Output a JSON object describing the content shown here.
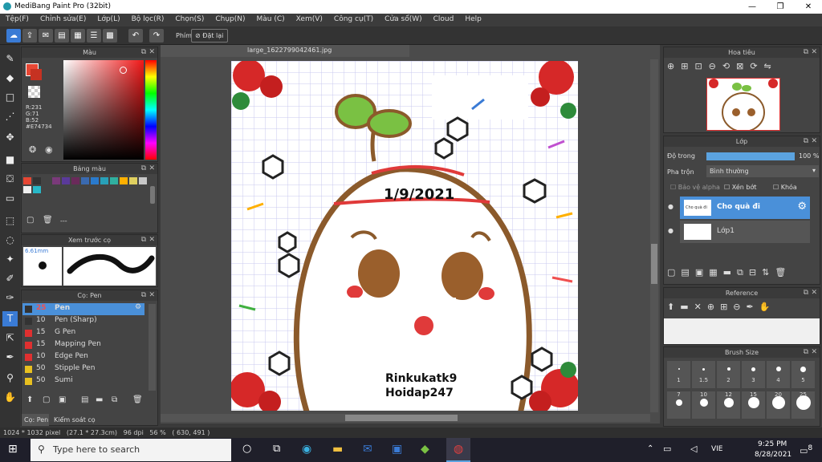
{
  "window": {
    "title": "MediBang Paint Pro (32bit)",
    "min": "—",
    "max": "❐",
    "close": "✕"
  },
  "menu": [
    "Tệp(F)",
    "Chỉnh sửa(E)",
    "Lớp(L)",
    "Bộ lọc(R)",
    "Chọn(S)",
    "Chụp(N)",
    "Màu (C)",
    "Xem(V)",
    "Công cụ(T)",
    "Cửa sổ(W)",
    "Cloud",
    "Help"
  ],
  "toolbar": {
    "shortcut_label": "Phím",
    "reset_label": "Đặt lại"
  },
  "color_panel": {
    "title": "Màu",
    "r": "R:231",
    "g": "G:71",
    "b": "B:52",
    "hex": "#E74734",
    "main_color": "#E74734"
  },
  "palette": {
    "title": "Bảng màu",
    "colors": [
      "#e74734",
      "#333333",
      "#444444",
      "#7a3a7a",
      "#5a3a9a",
      "#6a2a5a",
      "#3a6ab0",
      "#2a7acc",
      "#28a0b8",
      "#30b0a0",
      "#ffb000",
      "#e0d060",
      "#c8c8c8",
      "#f0f0f0",
      "#28b8c8"
    ],
    "footer": "---"
  },
  "brush_preview": {
    "title": "Xem trước cọ",
    "size": "6.61mm"
  },
  "brush_panel": {
    "title": "Cọ: Pen",
    "items": [
      {
        "size": "25",
        "name": "Pen",
        "color": "#333333"
      },
      {
        "size": "10",
        "name": "Pen (Sharp)",
        "color": "#333333"
      },
      {
        "size": "15",
        "name": "G Pen",
        "color": "#e03030"
      },
      {
        "size": "15",
        "name": "Mapping Pen",
        "color": "#e03030"
      },
      {
        "size": "10",
        "name": "Edge Pen",
        "color": "#e03030"
      },
      {
        "size": "50",
        "name": "Stipple Pen",
        "color": "#e8c020"
      },
      {
        "size": "50",
        "name": "Sumi",
        "color": "#e8c020"
      }
    ],
    "tab1": "Cọ: Pen",
    "tab2": "Kiểm soát cọ"
  },
  "document": {
    "filename": "large_1622799042461.jpg"
  },
  "artwork": {
    "date": "1/9/2021",
    "line1": "Rinkukatk9",
    "line2": "Hoidap247"
  },
  "navigator": {
    "title": "Hoa tiêu"
  },
  "layer_panel": {
    "title": "Lớp",
    "opacity_label": "Độ trong",
    "opacity_value": "100 %",
    "opacity_fraction": 1.0,
    "blend_label": "Pha trộn",
    "blend_value": "Bình thường",
    "protect_alpha": "Bảo vệ alpha",
    "clip": "Xén bớt",
    "lock": "Khóa",
    "layers": [
      {
        "name": "Cho quà đi",
        "thumb_text": "Cho quà đi"
      },
      {
        "name": "Lớp1"
      }
    ]
  },
  "reference": {
    "title": "Reference"
  },
  "brush_size": {
    "title": "Brush Size",
    "row1": [
      "1",
      "1.5",
      "2",
      "3",
      "4",
      "5"
    ],
    "row2": [
      "7",
      "10",
      "12",
      "15",
      "20",
      "25"
    ]
  },
  "status": {
    "text": "1024 * 1032 pixel   (27.1 * 27.3cm)   96 dpi   56 %   ( 630, 491 )"
  },
  "taskbar": {
    "search_placeholder": "Type here to search",
    "lang": "VIE",
    "time": "9:25 PM",
    "date": "8/28/2021",
    "notif": "8"
  }
}
